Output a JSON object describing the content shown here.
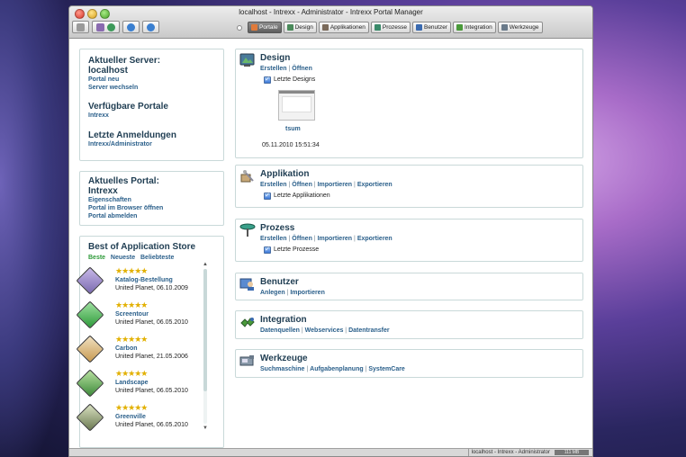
{
  "window": {
    "title": "localhost - Intrexx - Administrator - Intrexx Portal Manager"
  },
  "tabs": [
    {
      "label": "Portale",
      "active": true
    },
    {
      "label": "Design",
      "active": false
    },
    {
      "label": "Applikationen",
      "active": false
    },
    {
      "label": "Prozesse",
      "active": false
    },
    {
      "label": "Benutzer",
      "active": false
    },
    {
      "label": "Integration",
      "active": false
    },
    {
      "label": "Werkzeuge",
      "active": false
    }
  ],
  "server_panel": {
    "heading_current": "Aktueller Server:",
    "server_name": "localhost",
    "link_new_portal": "Portal neu",
    "link_switch_server": "Server wechseln",
    "heading_portals": "Verfügbare Portale",
    "portal_link": "Intrexx",
    "heading_logins": "Letzte Anmeldungen",
    "login_link": "Intrexx/Administrator"
  },
  "portal_panel": {
    "heading": "Aktuelles Portal:",
    "portal_name": "Intrexx",
    "link_properties": "Eigenschaften",
    "link_open_browser": "Portal im Browser öffnen",
    "link_logout": "Portal abmelden"
  },
  "store_panel": {
    "heading": "Best of Application Store",
    "filters": [
      "Beste",
      "Neueste",
      "Beliebteste"
    ],
    "items": [
      {
        "stars": "★★★★★",
        "name": "Katalog-Bestellung",
        "meta": "United Planet, 06.10.2009",
        "color": "#7b6bb0"
      },
      {
        "stars": "★★★★★",
        "name": "Screentour",
        "meta": "United Planet, 06.05.2010",
        "color": "#2e9a3a"
      },
      {
        "stars": "★★★★★",
        "name": "Carbon",
        "meta": "United Planet, 21.05.2006",
        "color": "#c89a52"
      },
      {
        "stars": "★★★★★",
        "name": "Landscape",
        "meta": "United Planet, 06.05.2010",
        "color": "#3d8a3a"
      },
      {
        "stars": "★★★★★",
        "name": "Greenville",
        "meta": "United Planet, 06.05.2010",
        "color": "#6c7a52"
      }
    ]
  },
  "sections": {
    "design": {
      "title": "Design",
      "links": [
        "Erstellen",
        "Öffnen"
      ],
      "check_label": "Letzte Designs",
      "thumb_label": "tsum",
      "timestamp": "05.11.2010 15:51:34"
    },
    "applikation": {
      "title": "Applikation",
      "links": [
        "Erstellen",
        "Öffnen",
        "Importieren",
        "Exportieren"
      ],
      "check_label": "Letzte Applikationen"
    },
    "prozess": {
      "title": "Prozess",
      "links": [
        "Erstellen",
        "Öffnen",
        "Importieren",
        "Exportieren"
      ],
      "check_label": "Letzte Prozesse"
    },
    "benutzer": {
      "title": "Benutzer",
      "links": [
        "Anlegen",
        "Importieren"
      ]
    },
    "integration": {
      "title": "Integration",
      "links": [
        "Datenquellen",
        "Webservices",
        "Datentransfer"
      ]
    },
    "werkzeuge": {
      "title": "Werkzeuge",
      "links": [
        "Suchmaschine",
        "Aufgabenplanung",
        "SystemCare"
      ]
    }
  },
  "status_bar": {
    "text": "localhost - Intrexx - Administrator",
    "memory": "111 MB"
  }
}
